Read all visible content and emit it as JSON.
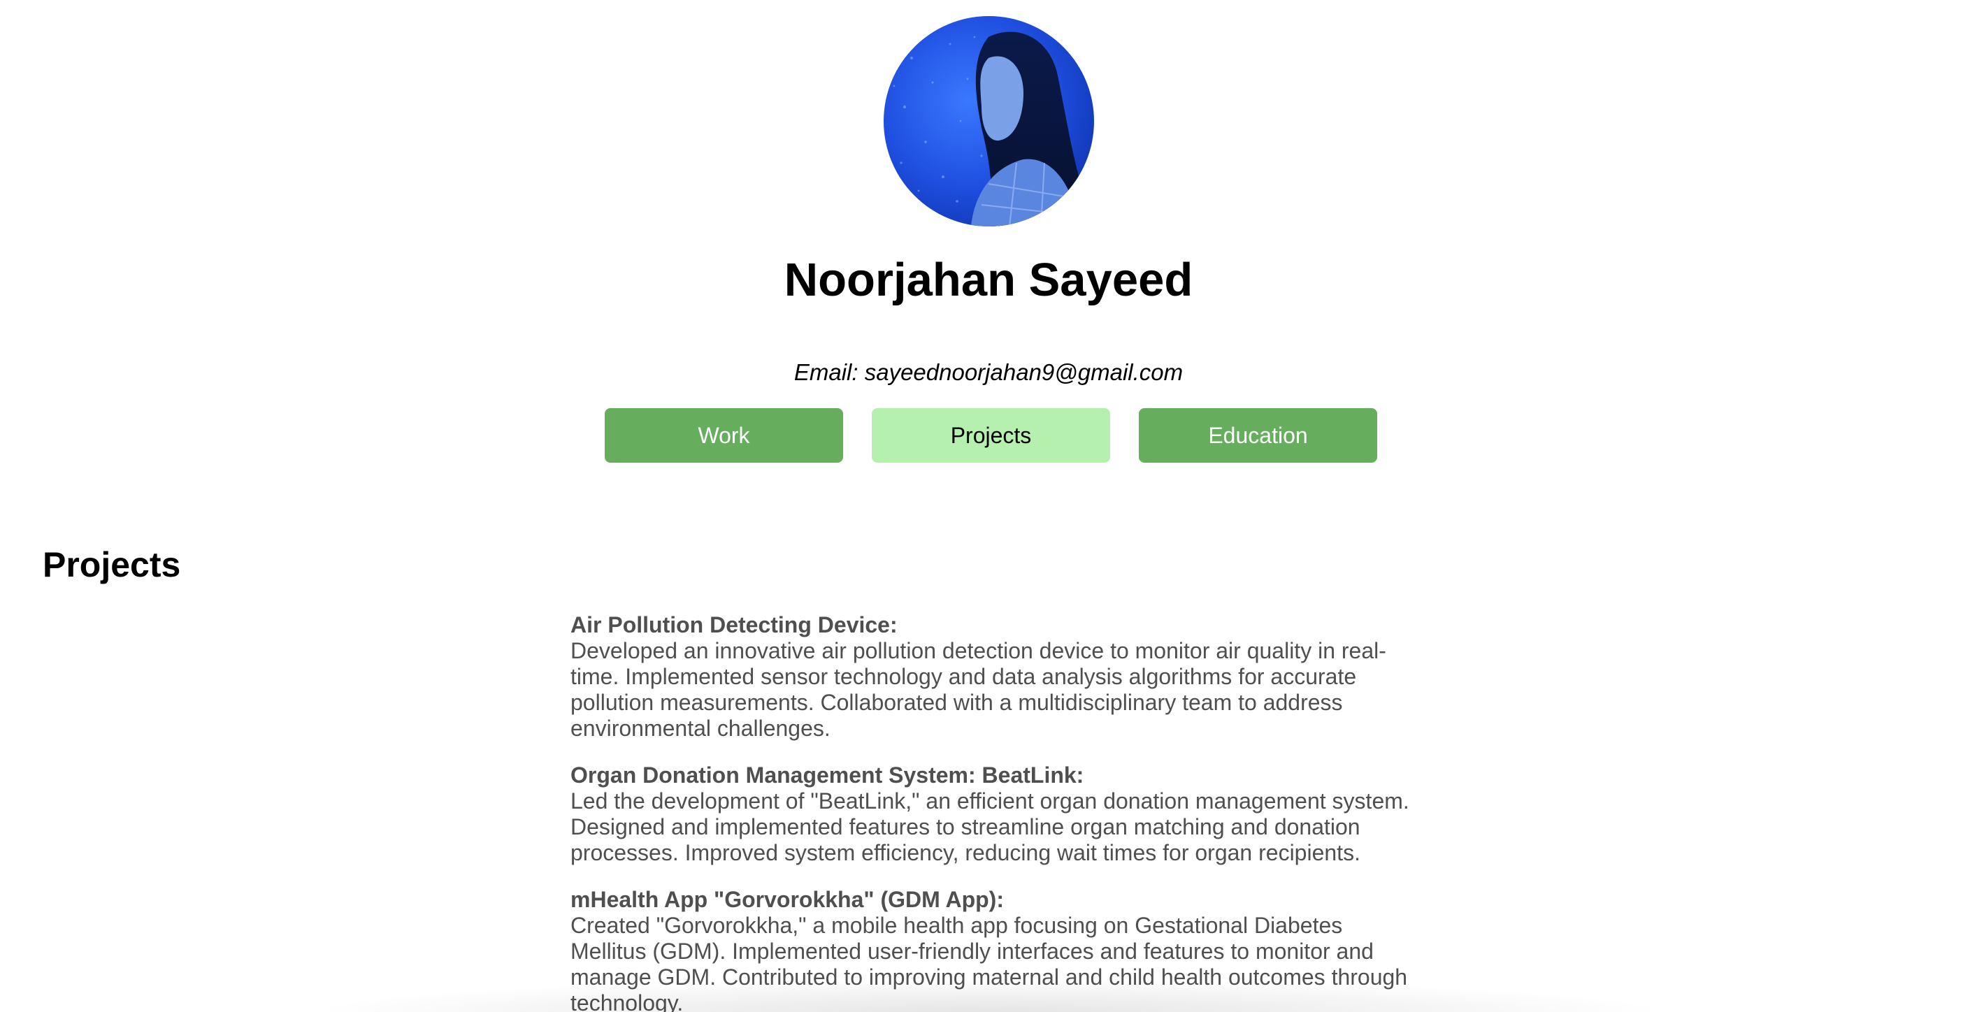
{
  "profile": {
    "name": "Noorjahan Sayeed",
    "email": "Email: sayeednoorjahan9@gmail.com"
  },
  "nav": {
    "work": "Work",
    "projects": "Projects",
    "education": "Education",
    "active": "Projects"
  },
  "section": {
    "title": "Projects"
  },
  "projects": [
    {
      "title": "Air Pollution Detecting Device:",
      "description": "Developed an innovative air pollution detection device to monitor air quality in real-time. Implemented sensor technology and data analysis algorithms for accurate pollution measurements. Collaborated with a multidisciplinary team to address environmental challenges."
    },
    {
      "title": "Organ Donation Management System: BeatLink:",
      "description": "Led the development of \"BeatLink,\" an efficient organ donation management system. Designed and implemented features to streamline organ matching and donation processes. Improved system efficiency, reducing wait times for organ recipients."
    },
    {
      "title": "mHealth App \"Gorvorokkha\" (GDM App):",
      "description": "Created \"Gorvorokkha,\" a mobile health app focusing on Gestational Diabetes Mellitus (GDM). Implemented user-friendly interfaces and features to monitor and manage GDM. Contributed to improving maternal and child health outcomes through technology."
    }
  ],
  "colors": {
    "button_inactive": "#67ad5e",
    "button_active": "#b5f0ae",
    "body_text": "#4f4f4f",
    "avatar_blue": "#1f4fe0"
  }
}
